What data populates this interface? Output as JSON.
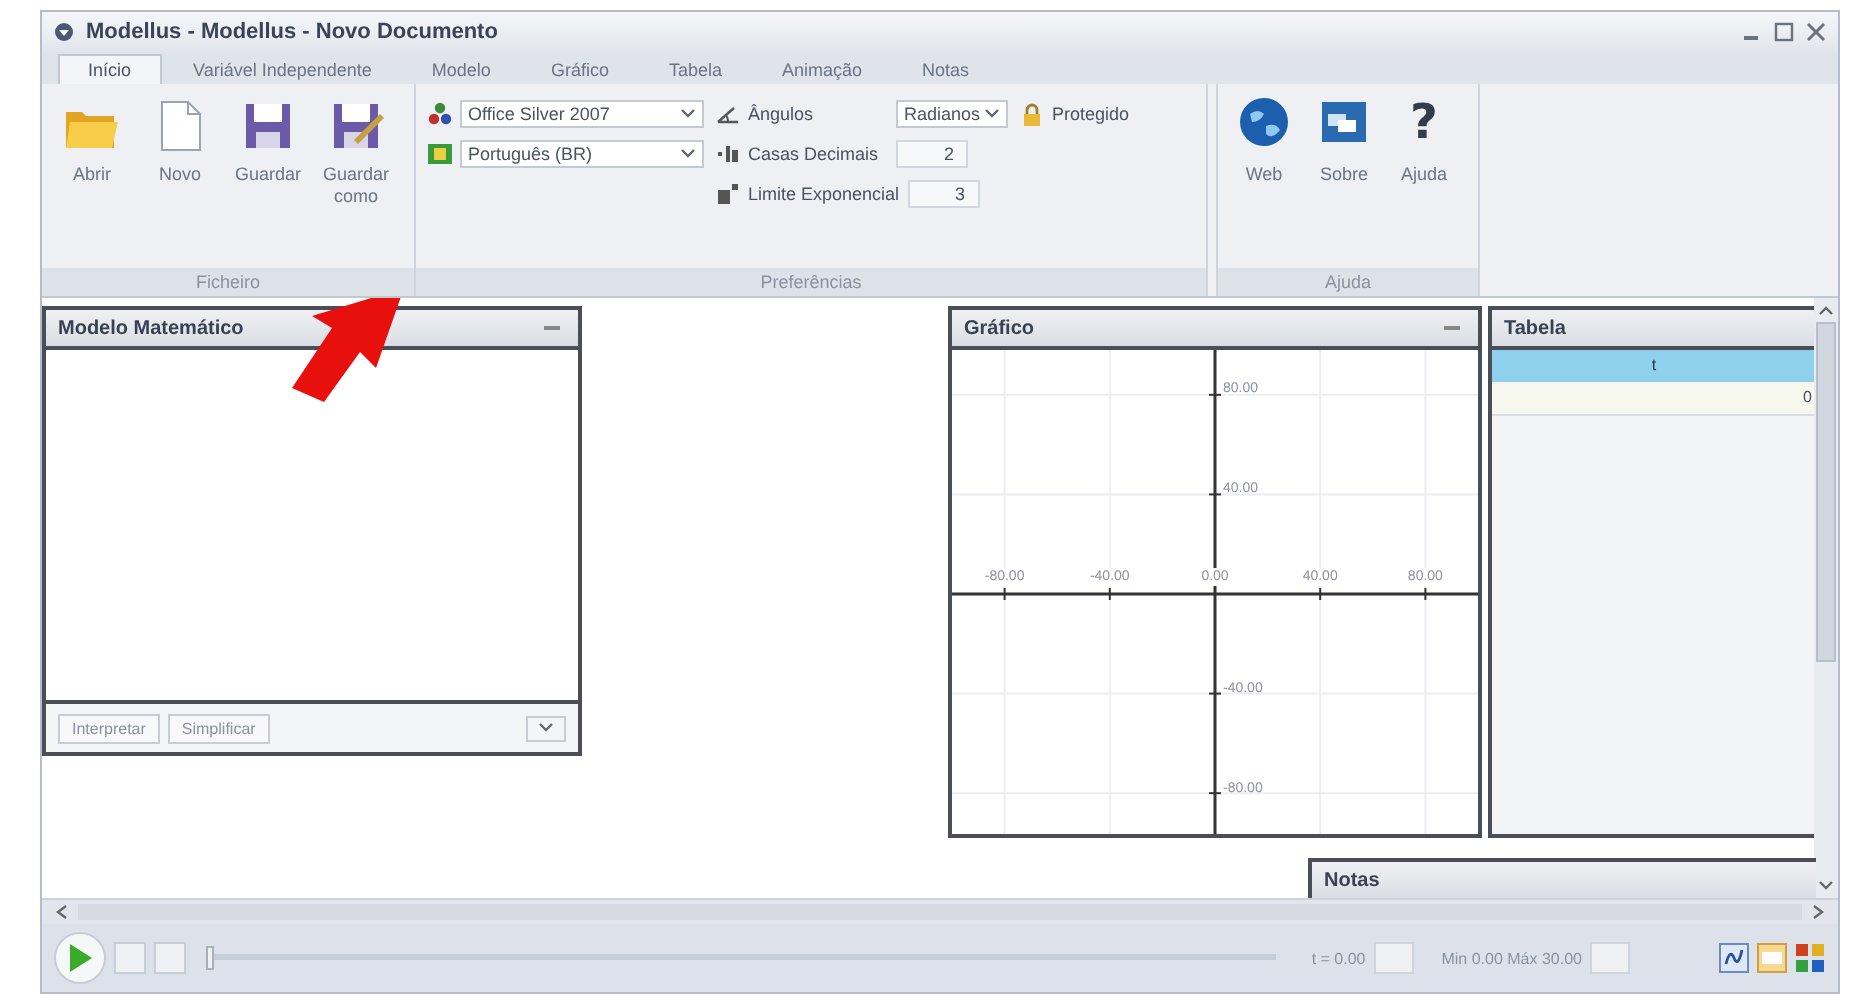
{
  "window": {
    "title": "Modellus - Modellus - Novo Documento"
  },
  "tabs": [
    {
      "label": "Início",
      "selected": true
    },
    {
      "label": "Variável Independente",
      "selected": false
    },
    {
      "label": "Modelo",
      "selected": false
    },
    {
      "label": "Gráfico",
      "selected": false
    },
    {
      "label": "Tabela",
      "selected": false
    },
    {
      "label": "Animação",
      "selected": false
    },
    {
      "label": "Notas",
      "selected": false
    }
  ],
  "ribbon": {
    "file_group": {
      "label": "Ficheiro",
      "buttons": [
        "Abrir",
        "Novo",
        "Guardar",
        "Guardar como"
      ]
    },
    "preferences_group": {
      "label": "Preferências",
      "theme": "Office Silver 2007",
      "language": "Português (BR)",
      "angles_label": "Ângulos",
      "angles_value": "Radianos",
      "decimals_label": "Casas Decimais",
      "decimals_value": "2",
      "exponent_label": "Limite Exponencial",
      "exponent_value": "3",
      "protected_label": "Protegido"
    },
    "help_group": {
      "label": "Ajuda",
      "buttons": [
        "Web",
        "Sobre",
        "Ajuda"
      ],
      "help_glyph": "?"
    }
  },
  "model_panel": {
    "title": "Modelo Matemático",
    "buttons": [
      "Interpretar",
      "Simplificar"
    ]
  },
  "graph_panel": {
    "title": "Gráfico",
    "chart_data": {
      "type": "line",
      "grid": true,
      "xlim": [
        -100,
        100
      ],
      "ylim": [
        -98,
        98
      ],
      "xticks": [
        {
          "value": -80,
          "label": "-80.00"
        },
        {
          "value": -40,
          "label": "-40.00"
        },
        {
          "value": 0,
          "label": "0.00"
        },
        {
          "value": 40,
          "label": "40.00"
        },
        {
          "value": 80,
          "label": "80.00"
        }
      ],
      "yticks": [
        {
          "value": 80,
          "label": "80.00"
        },
        {
          "value": 40,
          "label": "40.00"
        },
        {
          "value": -40,
          "label": "-40.00"
        },
        {
          "value": -80,
          "label": "-80.00"
        }
      ]
    }
  },
  "table_panel": {
    "title": "Tabela",
    "columns": [
      "t"
    ],
    "rows": [
      [
        "0"
      ]
    ]
  },
  "notes_panel": {
    "title": "Notas"
  },
  "player": {
    "level": 0,
    "time": "t = 0.00",
    "range": "Min 0.00 Máx 30.00"
  }
}
